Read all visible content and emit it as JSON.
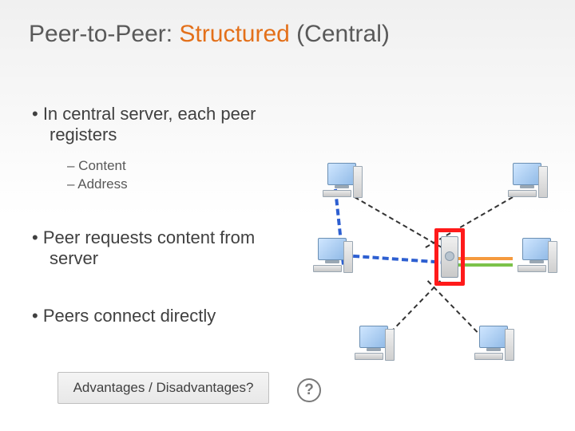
{
  "title": {
    "prefix": "Peer-to-Peer: ",
    "accent": "Structured",
    "suffix": " (Central)"
  },
  "bullets": {
    "b1": "•  In central server, each peer registers",
    "b1a": "–  Content",
    "b1b": "–  Address",
    "b2": "•  Peer requests content from server",
    "b3": "•  Peers connect directly"
  },
  "footer": {
    "text": "Advantages / Disadvantages?",
    "badge": "?"
  },
  "diagram": {
    "nodes": [
      "peer-top-left",
      "peer-top-right",
      "peer-mid-left",
      "server-center",
      "peer-mid-right",
      "peer-bottom-left",
      "peer-bottom-right"
    ]
  }
}
